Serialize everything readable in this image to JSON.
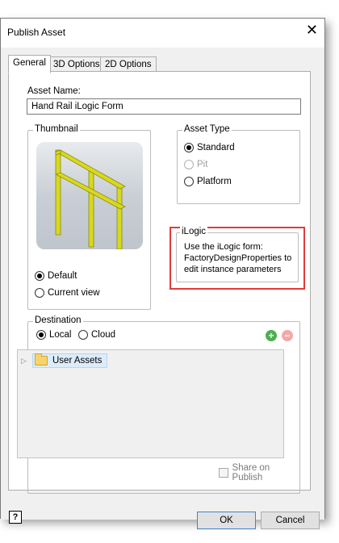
{
  "window": {
    "title": "Publish Asset",
    "close_glyph": "✕"
  },
  "tabs": [
    {
      "label": "General",
      "active": true
    },
    {
      "label": "3D Options",
      "active": false
    },
    {
      "label": "2D Options",
      "active": false
    }
  ],
  "asset_name": {
    "label": "Asset Name:",
    "value": "Hand Rail iLogic Form"
  },
  "thumbnail": {
    "legend": "Thumbnail",
    "options": [
      {
        "label": "Default",
        "checked": true
      },
      {
        "label": "Current view",
        "checked": false
      }
    ]
  },
  "asset_type": {
    "legend": "Asset Type",
    "options": [
      {
        "label": "Standard",
        "checked": true,
        "disabled": false
      },
      {
        "label": "Pit",
        "checked": false,
        "disabled": true
      },
      {
        "label": "Platform",
        "checked": false,
        "disabled": false
      }
    ]
  },
  "ilogic": {
    "legend": "iLogic",
    "text": "Use the iLogic form: FactoryDesignProperties to edit instance parameters",
    "highlight_color": "#e03c3c"
  },
  "destination": {
    "legend": "Destination",
    "options": [
      {
        "label": "Local",
        "checked": true
      },
      {
        "label": "Cloud",
        "checked": false
      }
    ],
    "add_icon": "plus-circle-icon",
    "remove_icon": "minus-circle-icon",
    "tree": [
      {
        "label": "User Assets",
        "selected": true,
        "icon": "folder-icon"
      }
    ]
  },
  "share": {
    "label": "Share on Publish",
    "checked": false,
    "disabled": true
  },
  "footer": {
    "help_glyph": "?",
    "ok_label": "OK",
    "cancel_label": "Cancel"
  },
  "colors": {
    "accent": "#3b84d4",
    "add": "#4caf50",
    "remove": "#f4a9a9",
    "rail": "#d8d81e"
  }
}
